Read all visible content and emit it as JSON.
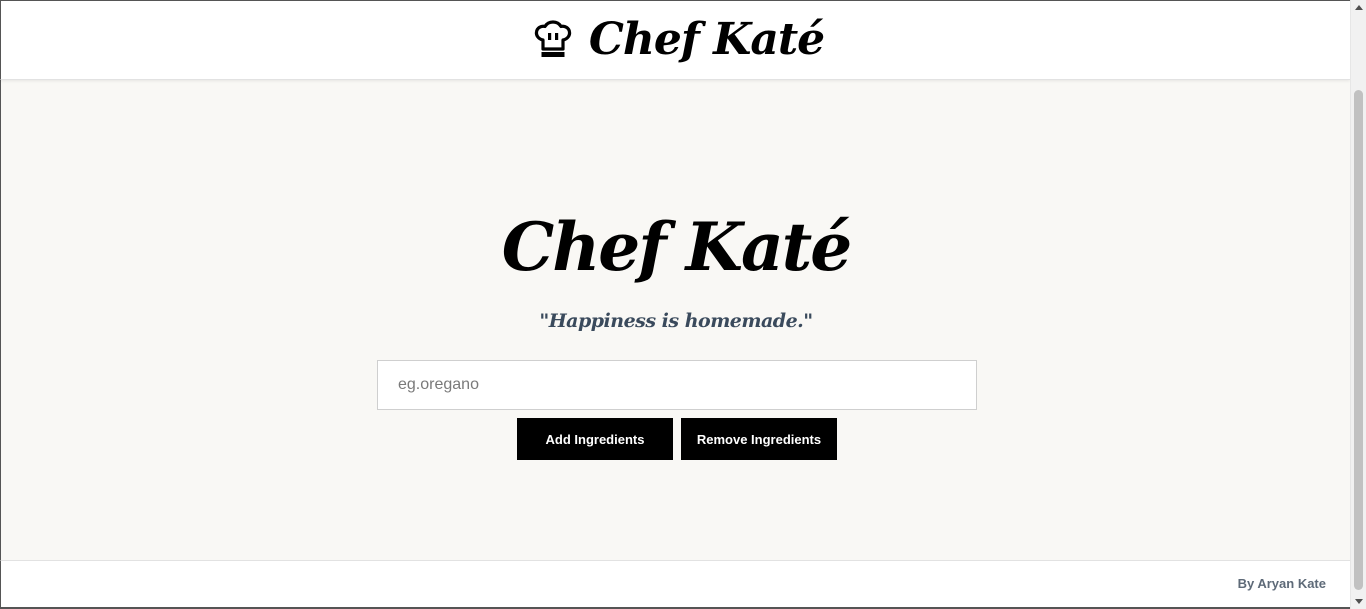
{
  "header": {
    "brand_title": "Chef Katé",
    "icon": "chef-hat-icon"
  },
  "hero": {
    "title": "Chef Katé",
    "tagline": "\"Happiness is homemade.\""
  },
  "ingredient_input": {
    "placeholder": "eg.oregano",
    "value": ""
  },
  "actions": {
    "add_label": "Add Ingredients",
    "remove_label": "Remove Ingredients"
  },
  "footer": {
    "credit": "By Aryan Kate"
  },
  "colors": {
    "page_background": "#f9f8f5",
    "header_background": "#ffffff",
    "button_background": "#000000",
    "button_text": "#ffffff",
    "tagline": "#3a4a5c",
    "footer_text": "#5e6a78"
  }
}
